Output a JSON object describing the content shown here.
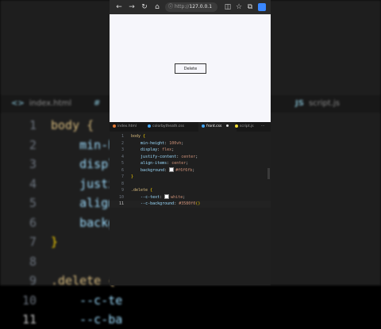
{
  "background_editor": {
    "tabs": [
      {
        "icon": "<>",
        "label": "index.html"
      },
      {
        "icon": "#",
        "label": ""
      },
      {
        "icon": "JS",
        "label": "script.js"
      }
    ],
    "lines": [
      {
        "num": "1",
        "code": "body {"
      },
      {
        "num": "2",
        "code": "    min-he"
      },
      {
        "num": "3",
        "code": "    displa"
      },
      {
        "num": "4",
        "code": "    justif"
      },
      {
        "num": "5",
        "code": "    align-"
      },
      {
        "num": "6",
        "code": "    backgr"
      },
      {
        "num": "7",
        "code": "}"
      },
      {
        "num": "8",
        "code": ""
      },
      {
        "num": "9",
        "code": ".delete {"
      },
      {
        "num": "10",
        "code": "    --c-te"
      },
      {
        "num": "11",
        "code": "    --c-ba"
      }
    ]
  },
  "browser": {
    "url_protocol": "http://",
    "url_host": "127.0.0.1",
    "nav_icons": [
      "back-icon",
      "forward-icon",
      "refresh-icon",
      "home-icon",
      "site-info-icon"
    ],
    "button_label": "Delete",
    "page_background": "#f6f6fb"
  },
  "editor": {
    "tabs": [
      {
        "label": "index.html",
        "color": "#e37933"
      },
      {
        "label": "colorbytheath.css",
        "color": "#42a5f5"
      },
      {
        "label": "front.css",
        "color": "#42a5f5",
        "active": true,
        "modified": true
      },
      {
        "label": "script.js",
        "color": "#f1dd35"
      }
    ],
    "more": "···",
    "lines": [
      {
        "num": "1",
        "parts": [
          [
            "sel",
            "body"
          ],
          [
            "punc",
            " "
          ],
          [
            "br",
            "{"
          ]
        ]
      },
      {
        "num": "2",
        "parts": [
          [
            "punc",
            "    "
          ],
          [
            "prop",
            "min-height"
          ],
          [
            "punc",
            ": "
          ],
          [
            "val",
            "100vh"
          ],
          [
            "punc",
            ";"
          ]
        ]
      },
      {
        "num": "3",
        "parts": [
          [
            "punc",
            "    "
          ],
          [
            "prop",
            "display"
          ],
          [
            "punc",
            ": "
          ],
          [
            "val",
            "flex"
          ],
          [
            "punc",
            ";"
          ]
        ]
      },
      {
        "num": "4",
        "parts": [
          [
            "punc",
            "    "
          ],
          [
            "prop",
            "justify-content"
          ],
          [
            "punc",
            ": "
          ],
          [
            "val",
            "center"
          ],
          [
            "punc",
            ";"
          ]
        ]
      },
      {
        "num": "5",
        "parts": [
          [
            "punc",
            "    "
          ],
          [
            "prop",
            "align-items"
          ],
          [
            "punc",
            ": "
          ],
          [
            "val",
            "center"
          ],
          [
            "punc",
            ";"
          ]
        ]
      },
      {
        "num": "6",
        "parts": [
          [
            "punc",
            "    "
          ],
          [
            "prop",
            "background"
          ],
          [
            "punc",
            ": "
          ],
          [
            "swatch",
            "#f6f6fb"
          ],
          [
            "val",
            "#f6f6fb"
          ],
          [
            "punc",
            ";"
          ]
        ]
      },
      {
        "num": "7",
        "parts": [
          [
            "br",
            "}"
          ]
        ]
      },
      {
        "num": "8",
        "parts": []
      },
      {
        "num": "9",
        "parts": [
          [
            "sel",
            ".delete"
          ],
          [
            "punc",
            " "
          ],
          [
            "br",
            "{"
          ]
        ]
      },
      {
        "num": "10",
        "parts": [
          [
            "punc",
            "    "
          ],
          [
            "prop",
            "--c-text"
          ],
          [
            "punc",
            ": "
          ],
          [
            "swatch",
            "#ffffff"
          ],
          [
            "val",
            "white"
          ],
          [
            "punc",
            ";"
          ]
        ]
      },
      {
        "num": "11",
        "parts": [
          [
            "punc",
            "    "
          ],
          [
            "prop",
            "--c-background"
          ],
          [
            "punc",
            ": "
          ],
          [
            "val",
            "#3580f0"
          ],
          [
            "br",
            "()"
          ]
        ],
        "current": true
      }
    ]
  },
  "colors": {
    "accent_blue": "#3a87ff",
    "editor_bg": "#1f1f1f"
  }
}
